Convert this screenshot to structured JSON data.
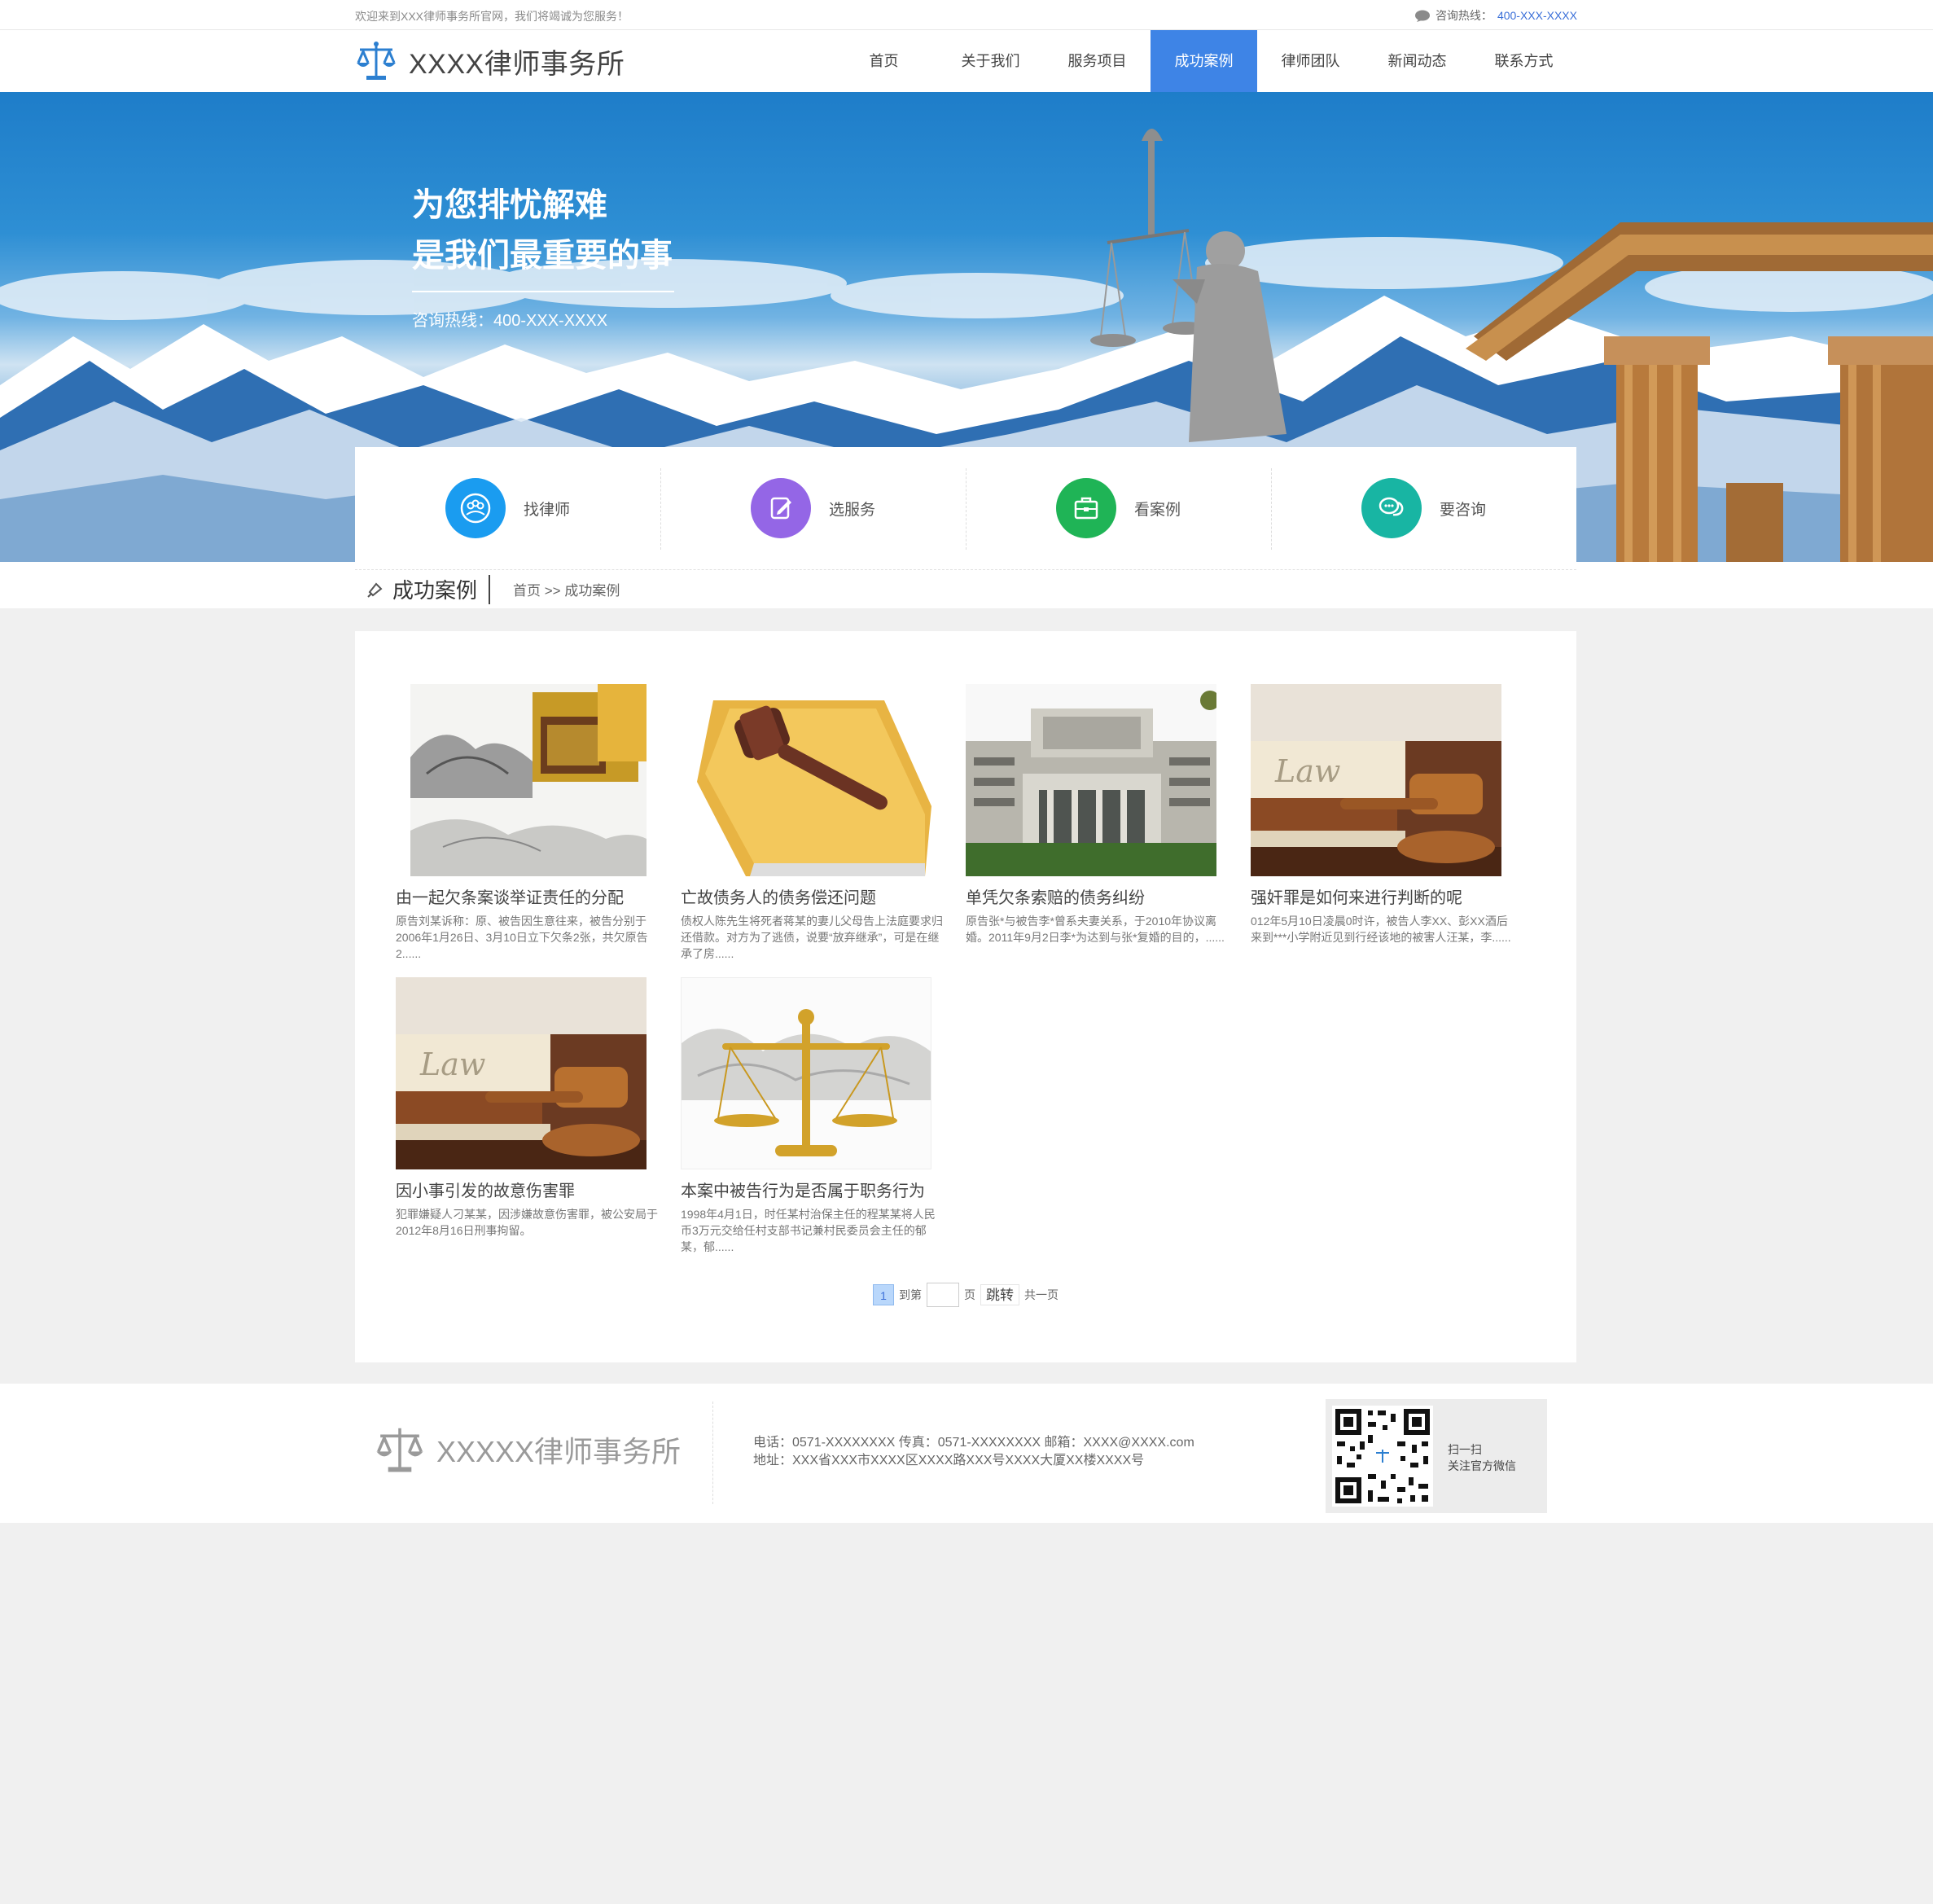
{
  "top": {
    "welcome": "欢迎来到XXX律师事务所官网，我们将竭诚为您服务！",
    "hotline_label": "咨询热线：",
    "hotline_number": "400-XXX-XXXX"
  },
  "header": {
    "logo_text": "XXXX律师事务所",
    "nav": [
      "首页",
      "关于我们",
      "服务项目",
      "成功案例",
      "律师团队",
      "新闻动态",
      "联系方式"
    ],
    "active_index": 3
  },
  "banner": {
    "line1": "为您排忧解难",
    "line2": "是我们最重要的事",
    "hotline": "咨询热线：400-XXX-XXXX"
  },
  "quick": [
    {
      "label": "找律师",
      "icon": "people-icon",
      "color": "#1a9cf0"
    },
    {
      "label": "选服务",
      "icon": "edit-icon",
      "color": "#9466e6"
    },
    {
      "label": "看案例",
      "icon": "briefcase-icon",
      "color": "#1fb456"
    },
    {
      "label": "要咨询",
      "icon": "chat-icon",
      "color": "#18b5a3"
    }
  ],
  "breadcrumb": {
    "section": "成功案例",
    "path": "首页 >> 成功案例"
  },
  "cases": [
    {
      "title": "由一起欠条案谈举证责任的分配",
      "desc": "原告刘某诉称：原、被告因生意往来，被告分别于2006年1月26日、3月10日立下欠条2张，共欠原告2......",
      "image": "ink-landscape-gavel"
    },
    {
      "title": "亡故债务人的债务偿还问题",
      "desc": "债权人陈先生将死者蒋某的妻儿父母告上法庭要求归还借款。对方为了逃债，说要“放弃继承”，可是在继承了房......",
      "image": "gavel-on-folder"
    },
    {
      "title": "单凭欠条索赔的债务纠纷",
      "desc": "原告张*与被告李*曾系夫妻关系，于2010年协议离婚。2011年9月2日李*为达到与张*复婚的目的，......",
      "image": "courthouse"
    },
    {
      "title": "强奸罪是如何来进行判断的呢",
      "desc": "012年5月10日凌晨0时许，被告人李XX、彭XX酒后来到***小学附近见到行经该地的被害人汪某，李......",
      "image": "law-books-gavel"
    },
    {
      "title": "因小事引发的故意伤害罪",
      "desc": "犯罪嫌疑人刁某某，因涉嫌故意伤害罪，被公安局于2012年8月16日刑事拘留。",
      "image": "law-books-gavel"
    },
    {
      "title": "本案中被告行为是否属于职务行为",
      "desc": "1998年4月1日，时任某村治保主任的程某某将人民币3万元交给任村支部书记兼村民委员会主任的郁某，郁......",
      "image": "golden-scales"
    }
  ],
  "pager": {
    "current": "1",
    "goto_prefix": "到第",
    "goto_suffix": "页",
    "go_button": "跳转",
    "total": "共一页"
  },
  "footer": {
    "logo_text": "XXXXX律师事务所",
    "line1": "电话：0571-XXXXXXXX 传真：0571-XXXXXXXX 邮箱：XXXX@XXXX.com",
    "line2": "地址：XXX省XXX市XXXX区XXXX路XXX号XXXX大厦XX楼XXXX号",
    "qr_line1": "扫一扫",
    "qr_line2": "关注官方微信"
  },
  "colors": {
    "accent": "#3e84e6",
    "hotline": "#3a6fd8"
  }
}
